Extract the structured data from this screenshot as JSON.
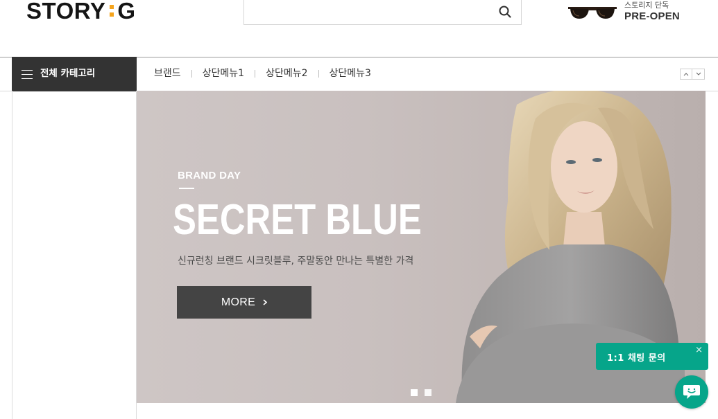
{
  "header": {
    "logo_left": "STORY",
    "logo_right": "G",
    "search": {
      "value": "",
      "placeholder": ""
    },
    "promo": {
      "sub": "스토리지 단독",
      "main": "PRE-OPEN"
    }
  },
  "nav": {
    "all_category": "전체 카테고리",
    "menu": [
      "브랜드",
      "상단메뉴1",
      "상단메뉴2",
      "상단메뉴3"
    ]
  },
  "banner": {
    "subtitle": "BRAND DAY",
    "title": "SECRET BLUE",
    "description": "신규런칭 브랜드 시크릿블루, 주말동안 만나는 특별한 가격",
    "button": "MORE",
    "slides_total": 2,
    "slide_active": 1
  },
  "chat": {
    "label": "1:1 채팅 문의",
    "close": "×"
  },
  "colors": {
    "accent": "#f5a41c",
    "nav_dark": "#333333",
    "chat_green": "#06a58a",
    "button_dark": "#444444"
  }
}
